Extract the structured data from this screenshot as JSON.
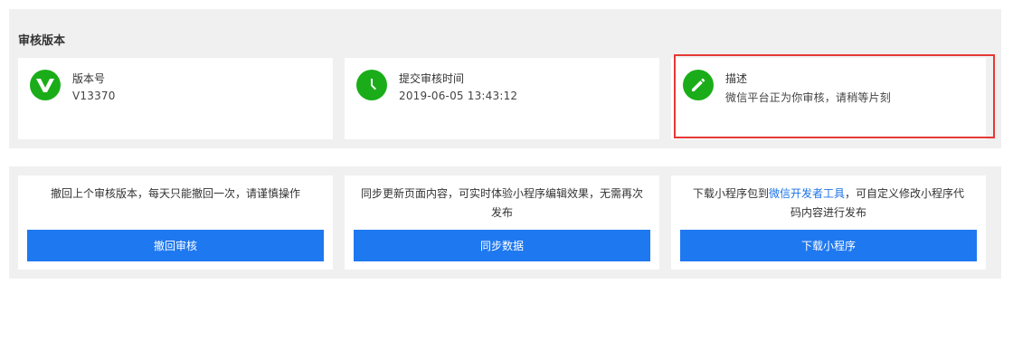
{
  "review_section": {
    "title": "审核版本",
    "cards": [
      {
        "label": "版本号",
        "value": "V13370",
        "icon": "v-logo-icon"
      },
      {
        "label": "提交审核时间",
        "value": "2019-06-05 13:43:12",
        "icon": "clock-icon"
      },
      {
        "label": "描述",
        "value": "微信平台正为你审核，请稍等片刻",
        "icon": "pencil-icon"
      }
    ]
  },
  "actions": [
    {
      "desc": "撤回上个审核版本，每天只能撤回一次，请谨慎操作",
      "button": "撤回审核"
    },
    {
      "desc": "同步更新页面内容，可实时体验小程序编辑效果，无需再次发布",
      "button": "同步数据"
    },
    {
      "desc_pre": "下载小程序包到",
      "desc_link": "微信开发者工具",
      "desc_post": "，可自定义修改小程序代码内容进行发布",
      "button": "下载小程序"
    }
  ],
  "colors": {
    "icon_green": "#1aad19",
    "button_blue": "#1e78f0",
    "link_blue": "#1a73e8",
    "highlight_red": "#e53935",
    "panel_gray": "#f0f0f0"
  }
}
